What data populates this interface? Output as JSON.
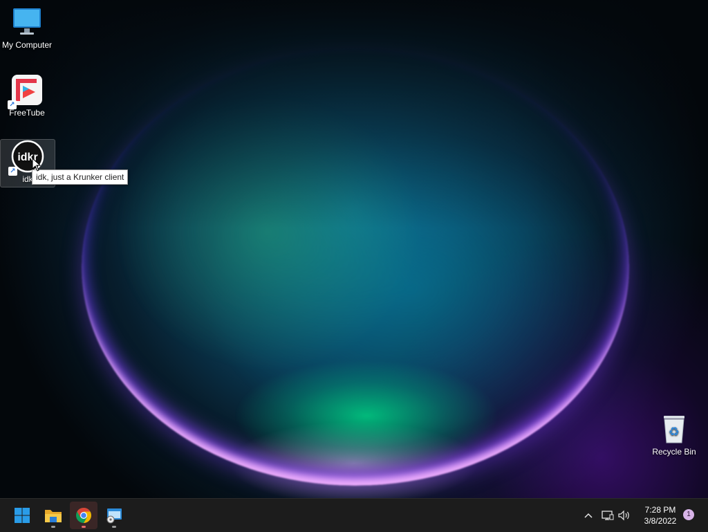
{
  "desktop": {
    "icons": [
      {
        "label": "My Computer",
        "icon": "monitor-icon"
      },
      {
        "label": "FreeTube",
        "icon": "freetube-icon",
        "glyph": "▶"
      },
      {
        "label": "idk",
        "icon": "idkr-icon",
        "glyph": "idkr"
      },
      {
        "label": "Recycle Bin",
        "icon": "recycle-bin-icon",
        "glyph": "♻"
      }
    ],
    "tooltip": "idk, just a Krunker client"
  },
  "taskbar": {
    "apps": [
      {
        "name": "Start",
        "icon": "windows-start-icon"
      },
      {
        "name": "File Explorer",
        "icon": "folder-icon"
      },
      {
        "name": "Google Chrome",
        "icon": "chrome-icon",
        "active": true
      },
      {
        "name": "Application",
        "icon": "app-window-icon"
      }
    ],
    "tray": {
      "chevron_glyph": "^",
      "network_icon": "network-icon",
      "volume_icon": "volume-icon",
      "time": "7:28 PM",
      "date": "3/8/2022",
      "notification_count": "1"
    }
  },
  "colors": {
    "taskbar_bg": "#1c1c1c",
    "accent_blue": "#2a9ce8",
    "chrome_red": "#db4437",
    "chrome_green": "#0f9d58",
    "chrome_yellow": "#f4b400",
    "notification_badge": "#d8b4e8"
  }
}
